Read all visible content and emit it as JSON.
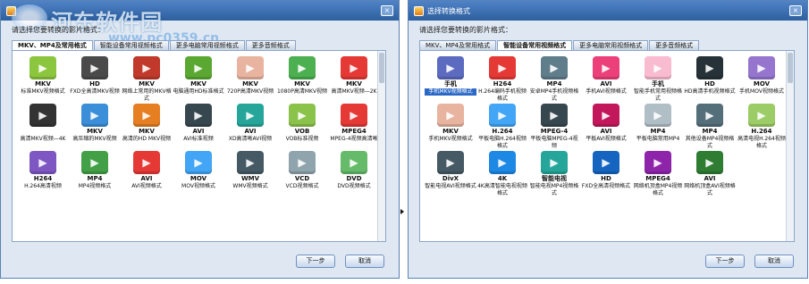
{
  "watermark": {
    "title": "河东软件园",
    "url": "www.pc0359.cn"
  },
  "left": {
    "prompt": "请选择您要转换的影片格式：",
    "tabs": [
      {
        "label": "MKV、MP4及常用格式",
        "active": true
      },
      {
        "label": "智能设备常用视频格式",
        "active": false
      },
      {
        "label": "更多电脑常用视频格式",
        "active": false
      },
      {
        "label": "更多音频格式",
        "active": false
      }
    ],
    "items": [
      {
        "icon": "mkv-cube-icon",
        "color": "#8cc63f",
        "badge": "MKV",
        "label": "标准MKV视频格式"
      },
      {
        "icon": "film-hd-icon",
        "color": "#4a4a4a",
        "badge": "HD",
        "label": "FXD全高清MKV视频"
      },
      {
        "icon": "film-reel-icon",
        "color": "#c0392b",
        "badge": "MKV",
        "label": "网络上常用的MKV格式"
      },
      {
        "icon": "leaf-icon",
        "color": "#5aa832",
        "badge": "MKV",
        "label": "电脑通用HD标准格式"
      },
      {
        "icon": "cards-icon",
        "color": "#e8b4a0",
        "badge": "MKV",
        "label": "720P高清MKV视频"
      },
      {
        "icon": "gift-box-icon",
        "color": "#4caf50",
        "badge": "MKV",
        "label": "1080P高清MKV视频"
      },
      {
        "icon": "youtube-icon",
        "color": "#e53935",
        "badge": "MKV",
        "label": "高清MKV视频—2K"
      },
      {
        "icon": "film-reel-4k-icon",
        "color": "#333333",
        "badge": "",
        "label": "高清MKV视频—4K"
      },
      {
        "icon": "clock-icon",
        "color": "#3a8fd8",
        "badge": "MKV",
        "label": "高压缩的MKV视频"
      },
      {
        "icon": "film-play-icon",
        "color": "#e67e22",
        "badge": "MKV",
        "label": "高清的HD MKV视频"
      },
      {
        "icon": "avi-screen-icon",
        "color": "#37474f",
        "badge": "AVI",
        "label": "AVI标准视频"
      },
      {
        "icon": "globe-icon",
        "color": "#26a69a",
        "badge": "AVI",
        "label": "XD高清晰AVI视频"
      },
      {
        "icon": "vob-disc-icon",
        "color": "#8bc34a",
        "badge": "VOB",
        "label": "VOB标准视频"
      },
      {
        "icon": "mpeg-play-icon",
        "color": "#e53935",
        "badge": "MPEG4",
        "label": "MPEG-4视频高清晰"
      },
      {
        "icon": "h264-circle-icon",
        "color": "#7e57c2",
        "badge": "H264",
        "label": "H.264高清视频"
      },
      {
        "icon": "mp4-desk-icon",
        "color": "#43a047",
        "badge": "MP4",
        "label": "MP4视频格式"
      },
      {
        "icon": "popcorn-icon",
        "color": "#e53935",
        "badge": "AVI",
        "label": "AVI视频格式"
      },
      {
        "icon": "mov-q-icon",
        "color": "#42a5f5",
        "badge": "MOV",
        "label": "MOV视频格式"
      },
      {
        "icon": "wmv-film-icon",
        "color": "#455a64",
        "badge": "WMV",
        "label": "WMV视频格式"
      },
      {
        "icon": "vcd-disc-icon",
        "color": "#90a4ae",
        "badge": "VCD",
        "label": "VCD视频格式"
      },
      {
        "icon": "dvd-disc-icon",
        "color": "#66bb6a",
        "badge": "DVD",
        "label": "DVD视频格式"
      }
    ],
    "buttons": {
      "next": "下一步",
      "cancel": "取消"
    }
  },
  "right": {
    "title": "选择转换格式",
    "prompt": "请选择您要转换的影片格式：",
    "tabs": [
      {
        "label": "MKV、MP4及常用格式",
        "active": false
      },
      {
        "label": "智能设备常用视频格式",
        "active": true
      },
      {
        "label": "更多电脑常用视频格式",
        "active": false
      },
      {
        "label": "更多音频格式",
        "active": false
      }
    ],
    "items": [
      {
        "icon": "phone-icon",
        "color": "#5c6bc0",
        "badge": "手机",
        "label": "手机MKV视频格式",
        "selected": true
      },
      {
        "icon": "phone-red-icon",
        "color": "#e53935",
        "badge": "H264",
        "label": "H.264编码手机视频格式"
      },
      {
        "icon": "android-phone-icon",
        "color": "#607d8b",
        "badge": "MP4",
        "label": "安卓MP4手机视频格式"
      },
      {
        "icon": "phone-avi-icon",
        "color": "#ec407a",
        "badge": "AVI",
        "label": "手机AVI视频格式"
      },
      {
        "icon": "phone-white-icon",
        "color": "#f8bbd0",
        "badge": "手机",
        "label": "智能手机常用视频格式"
      },
      {
        "icon": "phone-hd-icon",
        "color": "#263238",
        "badge": "HD",
        "label": "HD高清手机视频格式"
      },
      {
        "icon": "phone-mov-icon",
        "color": "#9575cd",
        "badge": "MOV",
        "label": "手机MOV视频格式"
      },
      {
        "icon": "cards-icon",
        "color": "#e8b4a0",
        "badge": "MKV",
        "label": "手机MKV视频格式"
      },
      {
        "icon": "tablet-icon",
        "color": "#42a5f5",
        "badge": "H.264",
        "label": "平板电脑H.264视频格式"
      },
      {
        "icon": "tablet-dark-icon",
        "color": "#37474f",
        "badge": "MPEG-4",
        "label": "平板电脑MPEG-4视频"
      },
      {
        "icon": "tablet-avi-icon",
        "color": "#c2185b",
        "badge": "AVI",
        "label": "平板AVI视频格式"
      },
      {
        "icon": "tablet-mp4-icon",
        "color": "#b0bec5",
        "badge": "MP4",
        "label": "平板电脑常用MP4"
      },
      {
        "icon": "device-mp4-icon",
        "color": "#546e7a",
        "badge": "MP4",
        "label": "其他设备MP4视频格式"
      },
      {
        "icon": "chameleon-icon",
        "color": "#9ccc65",
        "badge": "H.264",
        "label": "高清电视H.264视频格式"
      },
      {
        "icon": "tv-divx-icon",
        "color": "#455a64",
        "badge": "DivX",
        "label": "智能电视AVI视频格式"
      },
      {
        "icon": "tv-4k-icon",
        "color": "#1e88e5",
        "badge": "4K",
        "label": "4K高清智能电视视频格式"
      },
      {
        "icon": "tv-smart-icon",
        "color": "#26a69a",
        "badge": "智能电视",
        "label": "智能电视MP4视频格式"
      },
      {
        "icon": "tv-hd-icon",
        "color": "#1565c0",
        "badge": "HD",
        "label": "FXD全高清视频格式"
      },
      {
        "icon": "mpeg4-leaf-icon",
        "color": "#8e24aa",
        "badge": "MPEG4",
        "label": "网络机顶盒MP4视频格式"
      },
      {
        "icon": "xbox-avi-icon",
        "color": "#2e7d32",
        "badge": "AVI",
        "label": "网络机顶盒AVI视频格式"
      }
    ],
    "buttons": {
      "next": "下一步",
      "cancel": "取消"
    }
  }
}
